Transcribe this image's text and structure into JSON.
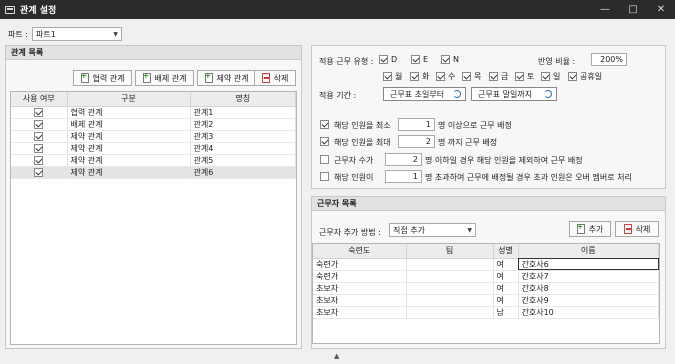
{
  "window": {
    "title": "관계 설정"
  },
  "part": {
    "label": "파트 :",
    "value": "파트1"
  },
  "relation_panel": {
    "title": "관계 목록",
    "buttons": {
      "cooperate": "협력 관계",
      "exclude": "배제 관계",
      "constrain": "제약 관계",
      "delete": "삭제"
    },
    "columns": [
      "사용 여부",
      "구분",
      "명칭"
    ],
    "rows": [
      {
        "used": true,
        "kind": "협력 관계",
        "name": "관계1"
      },
      {
        "used": true,
        "kind": "배제 관계",
        "name": "관계2"
      },
      {
        "used": true,
        "kind": "제약 관계",
        "name": "관계3"
      },
      {
        "used": true,
        "kind": "제약 관계",
        "name": "관계4"
      },
      {
        "used": true,
        "kind": "제약 관계",
        "name": "관계5"
      },
      {
        "used": true,
        "kind": "제약 관계",
        "name": "관계6"
      }
    ]
  },
  "settings": {
    "type_label": "적용 근무 유형 :",
    "types": [
      {
        "label": "D",
        "on": true
      },
      {
        "label": "E",
        "on": true
      },
      {
        "label": "N",
        "on": true
      }
    ],
    "ratio_label": "반영 비율 :",
    "ratio_value": "200%",
    "days": [
      {
        "label": "월",
        "on": true
      },
      {
        "label": "화",
        "on": true
      },
      {
        "label": "수",
        "on": true
      },
      {
        "label": "목",
        "on": true
      },
      {
        "label": "금",
        "on": true
      },
      {
        "label": "토",
        "on": true
      },
      {
        "label": "일",
        "on": true
      },
      {
        "label": "공휴일",
        "on": true
      }
    ],
    "period_label": "적용 기간 :",
    "period_from": "근무표 초일부터",
    "period_to": "근무표 말일까지",
    "rules": [
      {
        "on": true,
        "pre": "해당 인원을 최소",
        "value": "1",
        "post": "명 이상으로 근무 배정"
      },
      {
        "on": true,
        "pre": "해당 인원을 최대",
        "value": "2",
        "post": "명 까지 근무 배정"
      },
      {
        "on": false,
        "pre": "근무자 수가",
        "value": "2",
        "post": "명 이하일 경우 해당 인원을 제외하여 근무 배정"
      },
      {
        "on": false,
        "pre": "해당 인원이",
        "value": "1",
        "post": "명 초과하여 근무에 배정될 경우 초과 인원은 오버 멤버로 처리"
      }
    ]
  },
  "worker_panel": {
    "title": "근무자 목록",
    "method_label": "근무자 추가 방법 :",
    "method_value": "직접 추가",
    "add": "추가",
    "delete": "삭제",
    "columns": [
      "숙련도",
      "팀",
      "성별",
      "이름"
    ],
    "rows": [
      {
        "skill": "숙련가",
        "team": "",
        "gender": "여",
        "name": "간호사6"
      },
      {
        "skill": "숙련가",
        "team": "",
        "gender": "여",
        "name": "간호사7"
      },
      {
        "skill": "초보자",
        "team": "",
        "gender": "여",
        "name": "간호사8"
      },
      {
        "skill": "초보자",
        "team": "",
        "gender": "여",
        "name": "간호사9"
      },
      {
        "skill": "초보자",
        "team": "",
        "gender": "남",
        "name": "간호사10"
      }
    ]
  }
}
